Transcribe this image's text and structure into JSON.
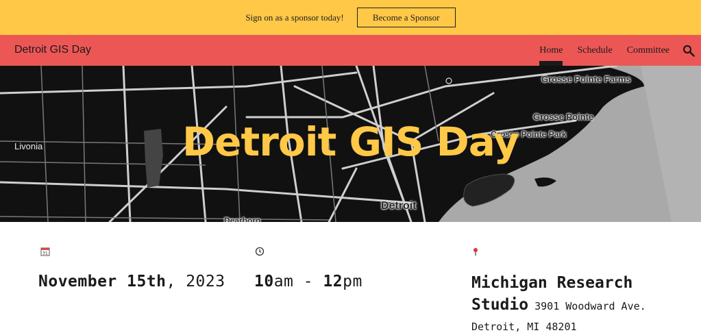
{
  "announcement": {
    "text": "Sign on as a sponsor today!",
    "button_label": "Become a Sponsor"
  },
  "nav": {
    "site_title": "Detroit GIS Day",
    "links": [
      {
        "label": "Home",
        "active": true
      },
      {
        "label": "Schedule",
        "active": false
      },
      {
        "label": "Committee",
        "active": false
      }
    ],
    "search_icon": "search-icon"
  },
  "hero": {
    "title": "Detroit GIS Day",
    "map_labels": {
      "livonia": "Livonia",
      "grosse_pointe_farms": "Grosse Pointe Farms",
      "grosse_pointe": "Grosse Pointe",
      "grosse_pointe_park": "Grosse Pointe Park",
      "detroit": "Detroit",
      "dearborn": "Dearborn"
    }
  },
  "event": {
    "date_icon": "calendar-icon",
    "date_bold": "November 15th",
    "date_light": ", 2023",
    "time_icon": "clock-icon",
    "time_start": "10",
    "time_start_suffix": "am - ",
    "time_end": "12",
    "time_end_suffix": "pm",
    "location_icon": "map-pin-icon",
    "venue_name": "Michigan Research Studio",
    "venue_address": " 3901 Woodward Ave. Detroit, MI 48201"
  },
  "colors": {
    "announcement_bg": "#ffc847",
    "nav_bg": "#ec5755",
    "hero_title": "#ffc847",
    "text": "#1a1a1a"
  }
}
